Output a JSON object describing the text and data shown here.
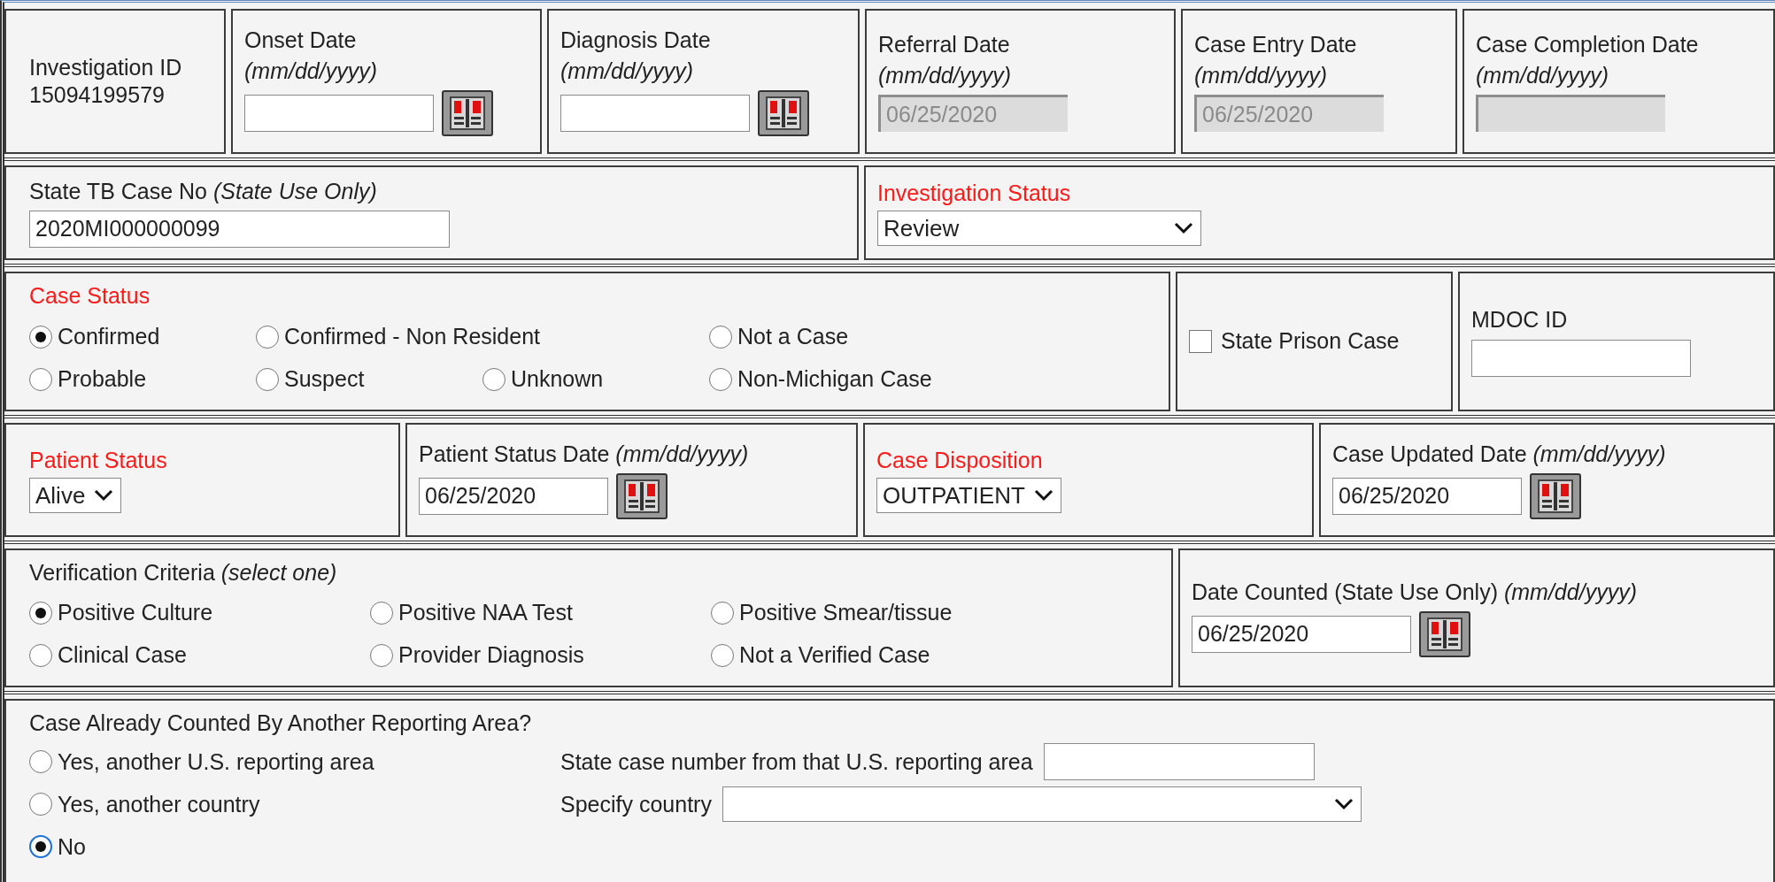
{
  "rows": [
    {
      "cells": [
        {
          "kind": "info",
          "label": "Investigation ID",
          "value": "15094199579"
        },
        {
          "kind": "date",
          "label": "Onset Date",
          "hint": "(mm/dd/yyyy)",
          "disabled": false
        },
        {
          "kind": "date",
          "label": "Diagnosis Date",
          "hint": "(mm/dd/yyyy)",
          "disabled": false
        },
        {
          "kind": "date",
          "label": "Referral Date",
          "hint": "(mm/dd/yyyy)",
          "value": "06/25/2020",
          "disabled": true
        },
        {
          "kind": "date",
          "label": "Case Entry Date",
          "hint": "(mm/dd/yyyy)",
          "value": "06/25/2020",
          "disabled": true
        },
        {
          "kind": "date",
          "label": "Case Completion Date",
          "hint": "(mm/dd/yyyy)",
          "disabled": true
        }
      ]
    },
    {
      "cells": [
        {
          "kind": "text",
          "label": "State TB Case No *(State Use Only)*",
          "value": "2020MI000000099",
          "required": false
        },
        {
          "kind": "select",
          "label": "Investigation Status",
          "value": "Review",
          "required": true
        }
      ]
    },
    {
      "cells": [
        {
          "kind": "radio",
          "label": "Case Status",
          "required": true,
          "option_rows": [
            [
              {
                "label": "Confirmed",
                "selected": true
              },
              {
                "label": "Confirmed - Non Resident",
                "selected": false
              },
              {
                "label": "Not a Case",
                "selected": false
              }
            ],
            [
              {
                "label": "Probable",
                "selected": false
              },
              {
                "label": "Suspect",
                "selected": false
              },
              {
                "label": "Unknown",
                "selected": false
              },
              {
                "label": "Non-Michigan Case",
                "selected": false
              }
            ]
          ]
        },
        {
          "kind": "checkbox",
          "label": "State Prison Case",
          "checked": false
        },
        {
          "kind": "text",
          "label": "MDOC ID",
          "required": false
        }
      ]
    },
    {
      "cells": [
        {
          "kind": "select",
          "label": "Patient Status",
          "value": "Alive",
          "required": true
        },
        {
          "kind": "date",
          "label": "Patient Status Date *(mm/dd/yyyy)*",
          "value": "06/25/2020",
          "disabled": false
        },
        {
          "kind": "select",
          "label": "Case Disposition",
          "value": "OUTPATIENT",
          "required": true
        },
        {
          "kind": "date",
          "label": "Case Updated Date *(mm/dd/yyyy)*",
          "value": "06/25/2020",
          "disabled": false
        }
      ]
    },
    {
      "cells": [
        {
          "kind": "radio",
          "label": "Verification Criteria *(select one)*",
          "required": false,
          "option_rows": [
            [
              {
                "label": "Positive Culture",
                "selected": true
              },
              {
                "label": "Positive NAA Test",
                "selected": false
              },
              {
                "label": "Positive Smear/tissue",
                "selected": false
              }
            ],
            [
              {
                "label": "Clinical Case",
                "selected": false
              },
              {
                "label": "Provider Diagnosis",
                "selected": false
              },
              {
                "label": "Not a Verified Case",
                "selected": false
              }
            ]
          ]
        },
        {
          "kind": "date",
          "label": "Date Counted (State Use Only) *(mm/dd/yyyy)*",
          "value": "06/25/2020",
          "disabled": false
        }
      ]
    },
    {
      "cells": [
        {
          "kind": "counted",
          "label": "Case Already Counted By Another Reporting Area?",
          "options": [
            {
              "label": "Yes, another U.S. reporting area",
              "selected": false,
              "focused": false
            },
            {
              "label": "Yes, another country",
              "selected": false,
              "focused": false
            },
            {
              "label": "No",
              "selected": true,
              "focused": true
            }
          ],
          "fields": [
            {
              "kind": "text",
              "label": "State case number from that U.S. reporting area"
            },
            {
              "kind": "select",
              "label": "Specify country"
            }
          ]
        }
      ]
    }
  ]
}
